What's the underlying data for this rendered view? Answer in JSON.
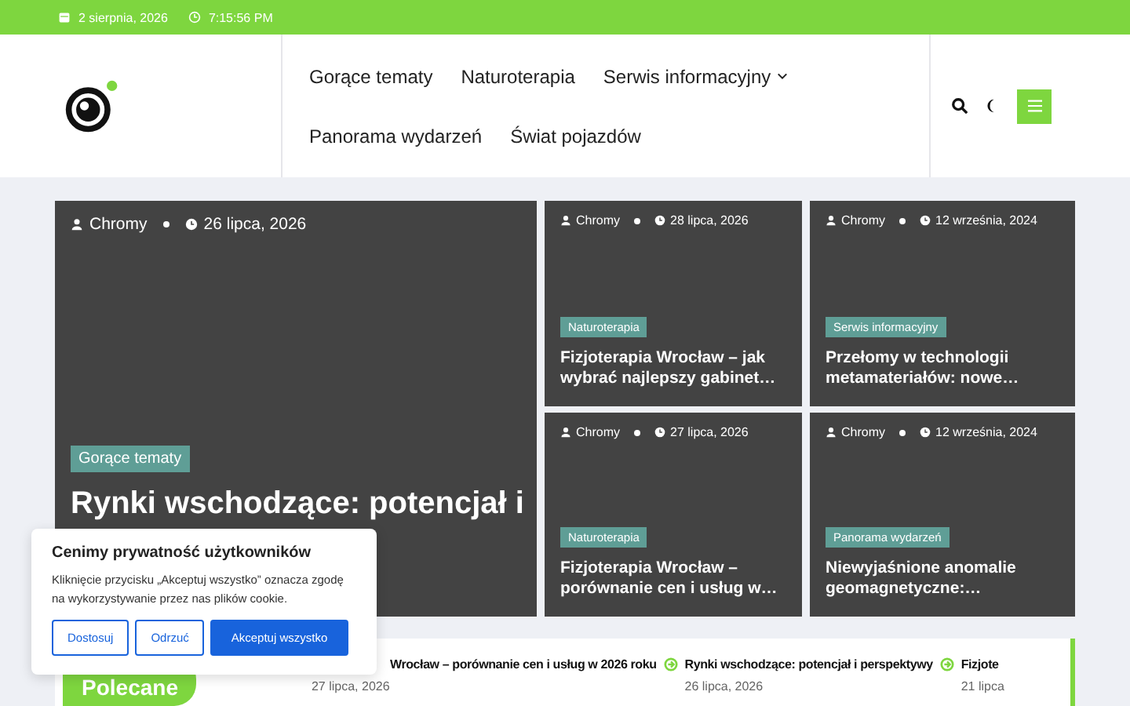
{
  "top_bar": {
    "date": "2 sierpnia, 2026",
    "time": "7:15:56 PM"
  },
  "nav": [
    {
      "label": "Gorące tematy",
      "dropdown": false
    },
    {
      "label": "Naturoterapia",
      "dropdown": false
    },
    {
      "label": "Serwis informacyjny",
      "dropdown": true
    },
    {
      "label": "Panorama wydarzeń",
      "dropdown": false
    },
    {
      "label": "Świat pojazdów",
      "dropdown": false
    }
  ],
  "featured": {
    "author": "Chromy",
    "date": "26 lipca, 2026",
    "category": "Gorące tematy",
    "title": "Rynki wschodzące: potencjał i"
  },
  "cards": [
    {
      "author": "Chromy",
      "date": "28 lipca, 2026",
      "category": "Naturoterapia",
      "title": "Fizjoterapia Wrocław – jak wybrać najlepszy gabinet…"
    },
    {
      "author": "Chromy",
      "date": "12 września, 2024",
      "category": "Serwis informacyjny",
      "title": "Przełomy w technologii metamateriałów: nowe…"
    },
    {
      "author": "Chromy",
      "date": "27 lipca, 2026",
      "category": "Naturoterapia",
      "title": "Fizjoterapia Wrocław – porównanie cen i usług w…"
    },
    {
      "author": "Chromy",
      "date": "12 września, 2024",
      "category": "Panorama wydarzeń",
      "title": "Niewyjaśnione anomalie geomagnetyczne:…"
    }
  ],
  "ticker": {
    "label": "Polecane",
    "items": [
      {
        "title": "Wrocław – porównanie cen i usług w 2026 roku",
        "date": "27 lipca, 2026",
        "icon": false
      },
      {
        "title": "Rynki wschodzące: potencjał i perspektywy",
        "date": "26 lipca, 2026",
        "icon": true
      },
      {
        "title": "Fizjote",
        "date": "21 lipca",
        "icon": true
      }
    ]
  },
  "cookie": {
    "title": "Cenimy prywatność użytkowników",
    "text": "Kliknięcie przycisku „Akceptuj wszystko” oznacza zgodę na wykorzystywanie przez nas plików cookie.",
    "buttons": [
      {
        "label": "Dostosuj",
        "kind": "outline"
      },
      {
        "label": "Odrzuć",
        "kind": "outline"
      },
      {
        "label": "Akceptuj wszystko",
        "kind": "primary"
      }
    ]
  }
}
